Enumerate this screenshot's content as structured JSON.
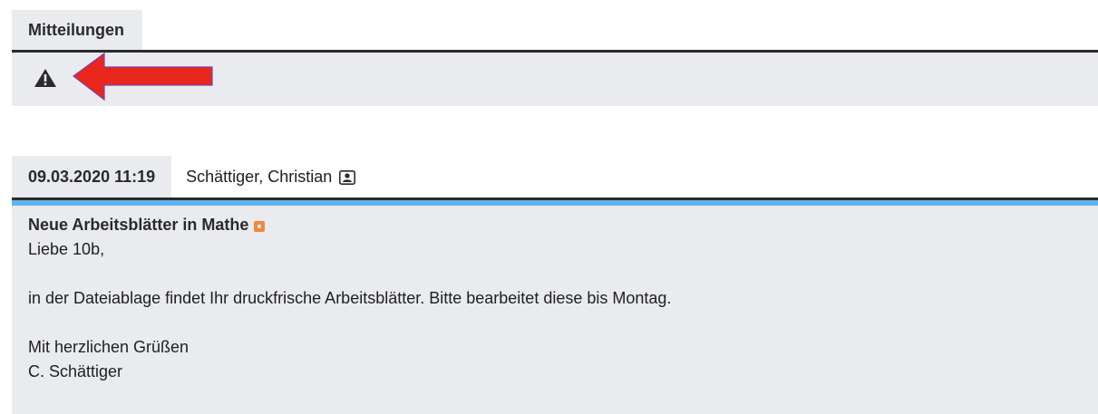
{
  "notices": {
    "tab_label": "Mitteilungen",
    "warning_icon": "warning-icon",
    "annotation": "red-arrow-pointing-left"
  },
  "message": {
    "date": "09.03.2020 11:19",
    "author": "Schättiger, Christian",
    "author_icon": "user-card-icon",
    "subject": "Neue Arbeitsblätter in Mathe",
    "new_icon": "new-badge-icon",
    "greeting": "Liebe 10b,",
    "body": "in der Dateiablage findet Ihr druckfrische Arbeitsblätter. Bitte bearbeitet diese bis Montag.",
    "closing": "Mit herzlichen Grüßen",
    "signature": "C. Schättiger"
  },
  "colors": {
    "panel_bg": "#e9ebee",
    "rule_dark": "#2b2b2b",
    "rule_accent": "#5fb4ec",
    "arrow": "#e8261b",
    "new_badge": "#ee8a3c"
  }
}
